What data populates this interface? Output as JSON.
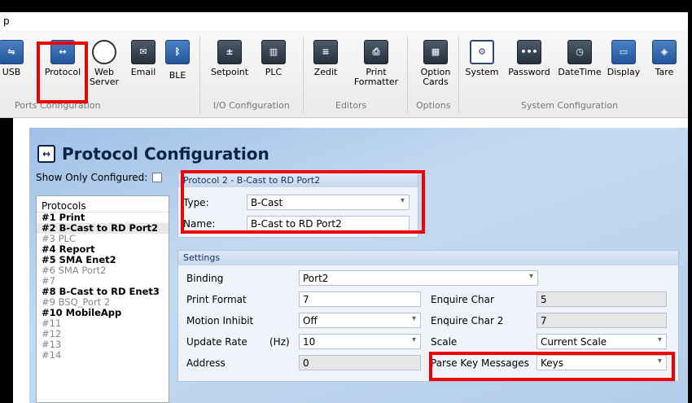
{
  "window": {
    "title": "p"
  },
  "ribbon": {
    "buttons": [
      {
        "label": "USB",
        "icon": "usb-icon"
      },
      {
        "label": "Protocol",
        "icon": "protocol-icon"
      },
      {
        "label": "Web Server",
        "icon": "web-server-icon"
      },
      {
        "label": "Email",
        "icon": "email-icon"
      },
      {
        "label": "BLE",
        "icon": "bluetooth-icon"
      },
      {
        "label": "Setpoint",
        "icon": "setpoint-icon"
      },
      {
        "label": "PLC",
        "icon": "plc-icon"
      },
      {
        "label": "Zedit",
        "icon": "zedit-icon"
      },
      {
        "label": "Print Formatter",
        "icon": "print-formatter-icon"
      },
      {
        "label": "Option Cards",
        "icon": "option-cards-icon"
      },
      {
        "label": "System",
        "icon": "system-icon"
      },
      {
        "label": "Password",
        "icon": "password-icon"
      },
      {
        "label": "DateTime",
        "icon": "datetime-icon"
      },
      {
        "label": "Display",
        "icon": "display-icon"
      },
      {
        "label": "Tare",
        "icon": "tare-icon"
      }
    ],
    "groups": [
      "Ports Configuration",
      "I/O Configuration",
      "Editors",
      "Options",
      "System Configuration"
    ]
  },
  "panel": {
    "title": "Protocol Configuration",
    "show_only_configured": "Show Only Configured:"
  },
  "protocols": {
    "header": "Protocols",
    "items": [
      {
        "label": "#1 Print",
        "configured": true
      },
      {
        "label": "#2 B-Cast to RD Port2",
        "configured": true,
        "selected": true
      },
      {
        "label": "#3 PLC",
        "configured": false
      },
      {
        "label": "#4 Report",
        "configured": true
      },
      {
        "label": "#5 SMA Enet2",
        "configured": true
      },
      {
        "label": "#6 SMA Port2",
        "configured": false
      },
      {
        "label": "#7",
        "configured": false
      },
      {
        "label": "#8 B-Cast to RD Enet3",
        "configured": true
      },
      {
        "label": "#9 BSQ_Port 2",
        "configured": false
      },
      {
        "label": "#10 MobileApp",
        "configured": true
      },
      {
        "label": "#11",
        "configured": false
      },
      {
        "label": "#12",
        "configured": false
      },
      {
        "label": "#13",
        "configured": false
      },
      {
        "label": "#14",
        "configured": false
      }
    ]
  },
  "protocol_box": {
    "header": "Protocol 2 - B-Cast to RD Port2",
    "type_label": "Type:",
    "type_value": "B-Cast",
    "name_label": "Name:",
    "name_value": "B-Cast to RD Port2"
  },
  "settings": {
    "header": "Settings",
    "binding_label": "Binding",
    "binding_value": "Port2",
    "print_format_label": "Print Format",
    "print_format_value": "7",
    "motion_inhibit_label": "Motion Inhibit",
    "motion_inhibit_value": "Off",
    "update_rate_label": "Update Rate",
    "update_rate_unit": "(Hz)",
    "update_rate_value": "10",
    "address_label": "Address",
    "address_value": "0",
    "enquire_char_label": "Enquire Char",
    "enquire_char_value": "5",
    "enquire_char2_label": "Enquire Char 2",
    "enquire_char2_value": "7",
    "scale_label": "Scale",
    "scale_value": "Current Scale",
    "parse_key_label": "Parse Key Messages",
    "parse_key_value": "Keys"
  },
  "colors": {
    "highlight": "#e00000",
    "panel_blue": "#b3cdea",
    "title_navy": "#0d2347"
  }
}
